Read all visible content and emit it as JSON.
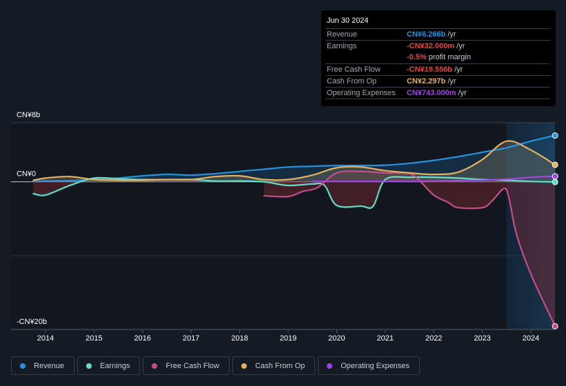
{
  "tooltip": {
    "date": "Jun 30 2024",
    "rows": [
      {
        "label": "Revenue",
        "value": "CN¥6.266b",
        "unit": " /yr",
        "color": "#2394df"
      },
      {
        "label": "Earnings",
        "value": "-CN¥32.000m",
        "unit": " /yr",
        "color": "#e64545"
      },
      {
        "label": "",
        "value": "-0.5%",
        "unit": " profit margin",
        "color": "#e64545"
      },
      {
        "label": "Free Cash Flow",
        "value": "-CN¥19.556b",
        "unit": " /yr",
        "color": "#e64545"
      },
      {
        "label": "Cash From Op",
        "value": "CN¥2.297b",
        "unit": " /yr",
        "color": "#e8b05e"
      },
      {
        "label": "Operating Expenses",
        "value": "CN¥743.000m",
        "unit": " /yr",
        "color": "#a044e8"
      }
    ]
  },
  "legend": [
    {
      "label": "Revenue",
      "color": "#2394df"
    },
    {
      "label": "Earnings",
      "color": "#5fe0cc"
    },
    {
      "label": "Free Cash Flow",
      "color": "#c84b8a"
    },
    {
      "label": "Cash From Op",
      "color": "#e8b05e"
    },
    {
      "label": "Operating Expenses",
      "color": "#a044e8"
    }
  ],
  "chart_data": {
    "type": "line",
    "title": "",
    "xlabel": "",
    "ylabel": "",
    "y_unit": "CN¥ billions",
    "ylim": [
      -20,
      8
    ],
    "xlim": [
      2013.3,
      2024.5
    ],
    "y_ticks": [
      {
        "value": 8,
        "label": "CN¥8b"
      },
      {
        "value": 0,
        "label": "CN¥0"
      },
      {
        "value": -20,
        "label": "-CN¥20b"
      }
    ],
    "x_ticks": [
      {
        "value": 2014,
        "label": "2014"
      },
      {
        "value": 2015,
        "label": "2015"
      },
      {
        "value": 2016,
        "label": "2016"
      },
      {
        "value": 2017,
        "label": "2017"
      },
      {
        "value": 2018,
        "label": "2018"
      },
      {
        "value": 2019,
        "label": "2019"
      },
      {
        "value": 2020,
        "label": "2020"
      },
      {
        "value": 2021,
        "label": "2021"
      },
      {
        "value": 2022,
        "label": "2022"
      },
      {
        "value": 2023,
        "label": "2023"
      },
      {
        "value": 2024,
        "label": "2024"
      }
    ],
    "highlight_start": 2023.5,
    "grid": true,
    "legend_position": "bottom",
    "series": [
      {
        "name": "Revenue",
        "color": "#2394df",
        "fill": true,
        "x": [
          2013.75,
          2014.5,
          2015,
          2015.5,
          2016,
          2016.5,
          2017,
          2017.5,
          2018,
          2018.5,
          2019,
          2019.5,
          2020,
          2020.5,
          2021,
          2021.5,
          2022,
          2022.5,
          2023,
          2023.5,
          2024,
          2024.5
        ],
        "y": [
          0.1,
          0.15,
          0.3,
          0.5,
          0.8,
          1.0,
          0.9,
          1.1,
          1.4,
          1.7,
          2.0,
          2.1,
          2.2,
          2.2,
          2.25,
          2.5,
          2.9,
          3.4,
          4.0,
          4.6,
          5.5,
          6.266
        ]
      },
      {
        "name": "Earnings",
        "color": "#5fe0cc",
        "fill": true,
        "x": [
          2013.75,
          2014,
          2014.5,
          2015,
          2015.5,
          2016,
          2016.5,
          2017,
          2017.5,
          2018,
          2018.5,
          2019,
          2019.5,
          2019.75,
          2020,
          2020.5,
          2020.75,
          2021,
          2021.5,
          2022,
          2022.5,
          2023,
          2023.5,
          2024,
          2024.5
        ],
        "y": [
          -1.6,
          -1.8,
          -0.5,
          0.5,
          0.4,
          0.3,
          0.3,
          0.3,
          0.1,
          0.1,
          0.0,
          -0.5,
          -0.3,
          -0.5,
          -3.2,
          -3.3,
          -3.3,
          0.3,
          0.6,
          0.6,
          0.5,
          0.3,
          0.2,
          0.05,
          -0.032
        ]
      },
      {
        "name": "Free Cash Flow",
        "color": "#c84b8a",
        "fill": true,
        "x": [
          2018.5,
          2019,
          2019.3,
          2019.6,
          2020,
          2020.5,
          2021,
          2021.5,
          2021.7,
          2022,
          2022.3,
          2022.5,
          2023,
          2023.2,
          2023.45,
          2023.55,
          2023.7,
          2024,
          2024.5
        ],
        "y": [
          -1.9,
          -2.0,
          -1.3,
          -0.8,
          1.2,
          1.4,
          1.2,
          1.1,
          0.2,
          -1.8,
          -2.8,
          -3.5,
          -3.5,
          -2.6,
          -0.9,
          -2.2,
          -7.0,
          -12.5,
          -19.556
        ]
      },
      {
        "name": "Cash From Op",
        "color": "#e8b05e",
        "fill": true,
        "x": [
          2013.75,
          2014,
          2014.5,
          2015,
          2015.5,
          2016,
          2016.5,
          2017,
          2017.5,
          2018,
          2018.5,
          2019,
          2019.5,
          2020,
          2020.5,
          2021,
          2021.5,
          2022,
          2022.5,
          2023,
          2023.5,
          2024,
          2024.5
        ],
        "y": [
          0.2,
          0.5,
          0.7,
          0.3,
          0.2,
          0.2,
          0.3,
          0.3,
          0.7,
          0.8,
          0.3,
          0.3,
          0.9,
          1.9,
          2.0,
          1.5,
          1.2,
          1.0,
          1.3,
          3.0,
          5.5,
          4.3,
          2.297
        ]
      },
      {
        "name": "Operating Expenses",
        "color": "#a044e8",
        "fill": false,
        "x": [
          2019.5,
          2020,
          2020.5,
          2021,
          2021.5,
          2022,
          2022.5,
          2023,
          2023.5,
          2024,
          2024.5
        ],
        "y": [
          0.05,
          0.05,
          0.05,
          0.05,
          0.05,
          0.1,
          0.15,
          0.2,
          0.35,
          0.6,
          0.743
        ]
      }
    ]
  }
}
